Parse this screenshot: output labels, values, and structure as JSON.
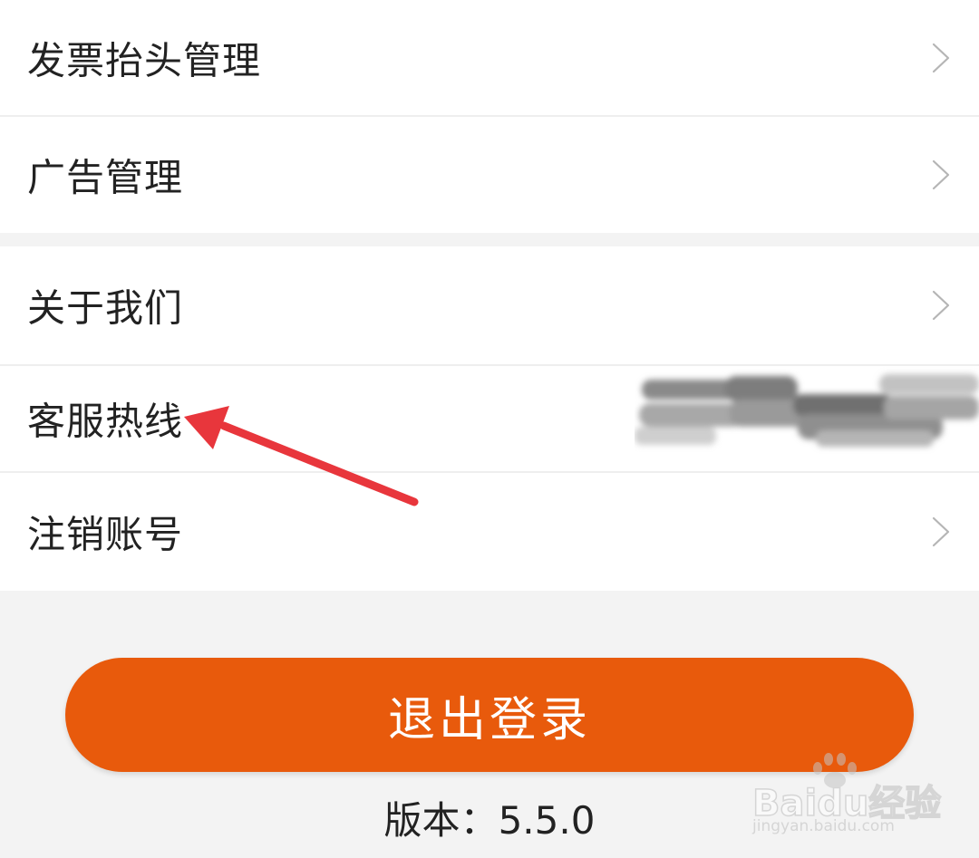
{
  "menu_group_1": {
    "items": [
      {
        "label": "发票抬头管理"
      },
      {
        "label": "广告管理"
      }
    ]
  },
  "menu_group_2": {
    "items": [
      {
        "label": "关于我们"
      },
      {
        "label": "客服热线"
      },
      {
        "label": "注销账号"
      }
    ]
  },
  "logout_button": {
    "label": "退出登录"
  },
  "version": {
    "prefix": "版本：",
    "number": "5.5.0"
  },
  "watermark": {
    "brand": "Baidu经验",
    "url": "jingyan.baidu.com"
  },
  "colors": {
    "accent": "#e85a0c",
    "annotation_arrow": "#e8363c",
    "background": "#f3f3f3",
    "row_background": "#ffffff"
  },
  "icons": [
    "chevron-right-icon",
    "annotation-arrow-icon",
    "baidu-paw-icon"
  ]
}
